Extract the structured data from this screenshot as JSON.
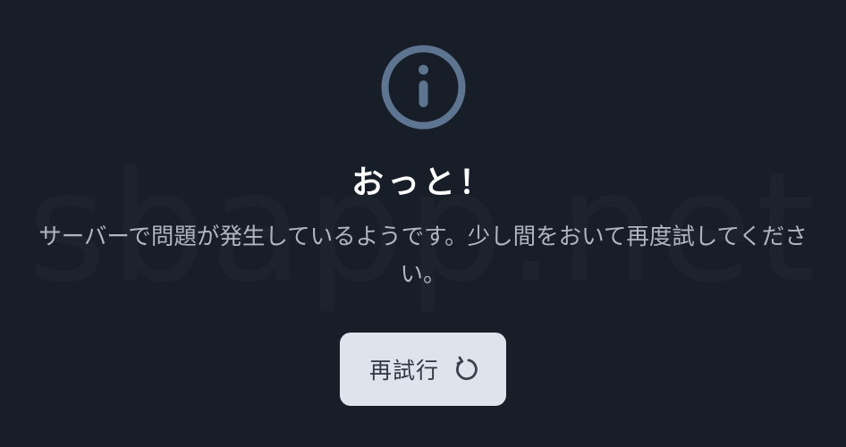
{
  "watermark": "sbapp.net",
  "icons": {
    "info": "info-circle-icon",
    "retry": "refresh-icon"
  },
  "colors": {
    "background": "#171e28",
    "icon": "#5d7590",
    "title": "#ffffff",
    "message": "#b0b6c0",
    "button_bg": "#dde4ec",
    "button_text": "#2f3542"
  },
  "error": {
    "title": "おっと！",
    "message": "サーバーで問題が発生しているようです。少し間をおいて再度試してください。",
    "retry_label": "再試行"
  }
}
